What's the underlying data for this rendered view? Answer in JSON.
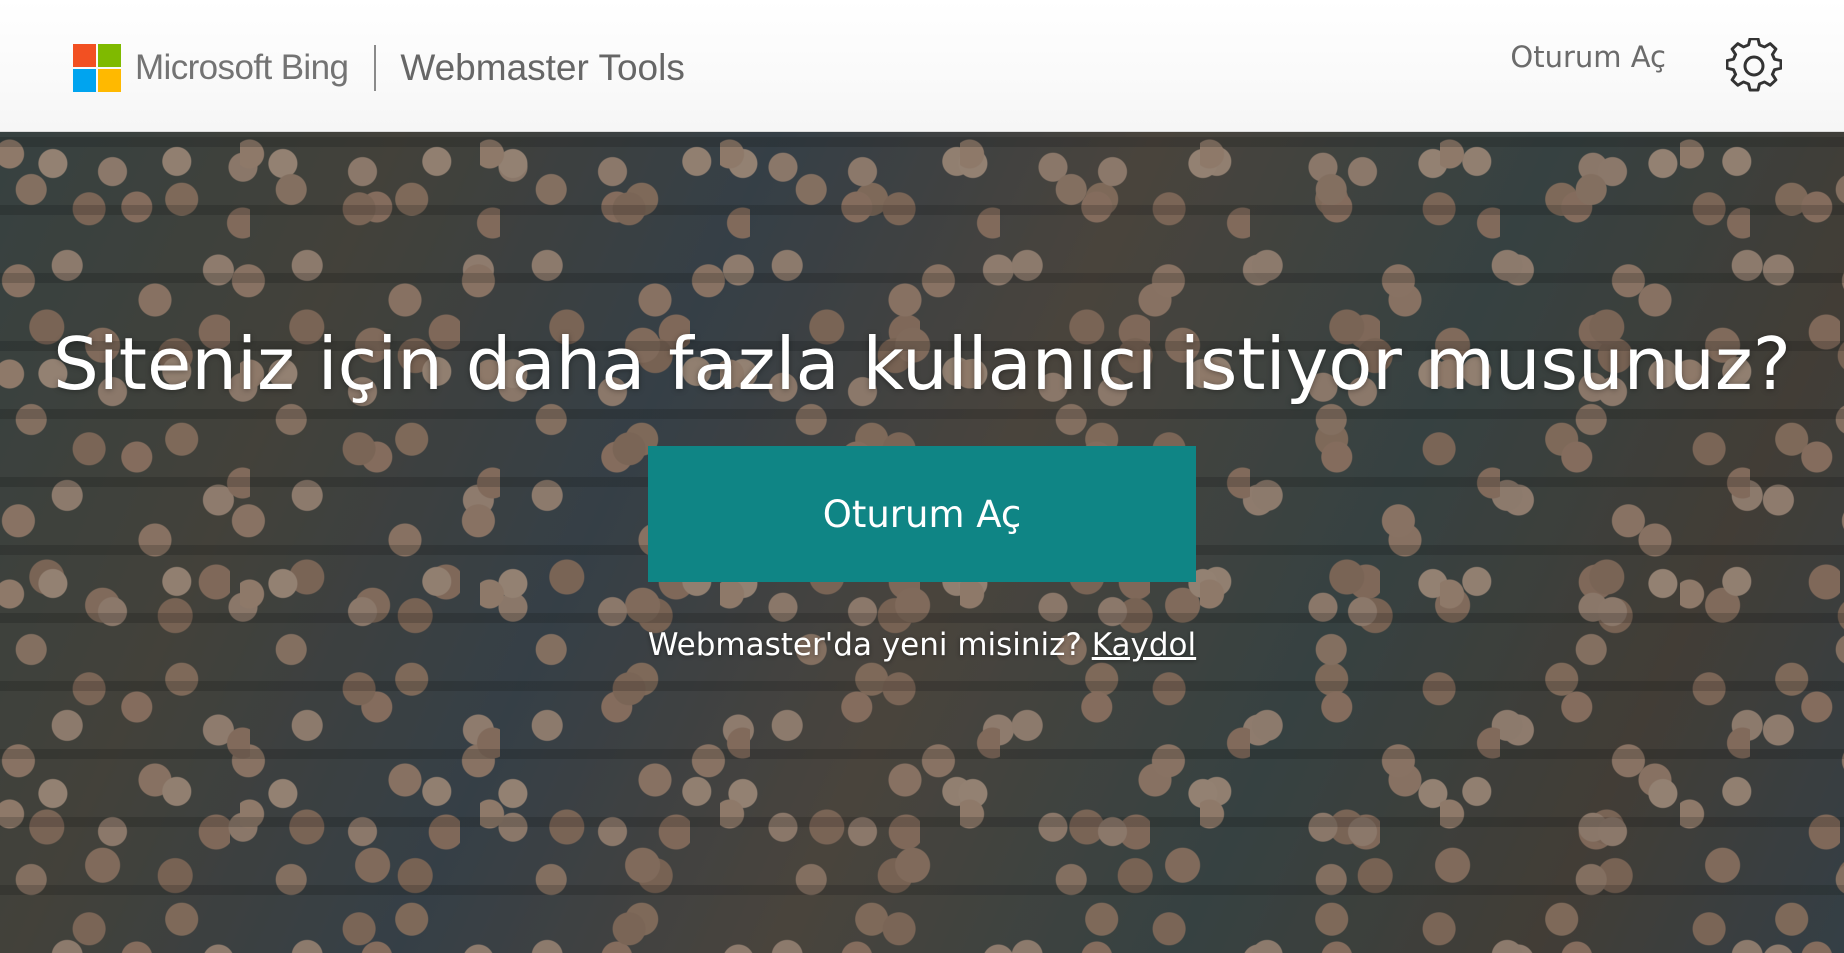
{
  "header": {
    "brand_name": "Microsoft Bing",
    "product_name": "Webmaster Tools",
    "signin_label": "Oturum Aç",
    "settings_icon": "gear-icon",
    "logo_colors": [
      "#f25022",
      "#7fba00",
      "#00a4ef",
      "#ffb900"
    ]
  },
  "hero": {
    "headline": "Siteniz için daha fazla kullanıcı istiyor musunuz?",
    "cta_label": "Oturum Aç",
    "signup_prompt": "Webmaster'da yeni misiniz?",
    "signup_link": "Kaydol"
  },
  "colors": {
    "cta_background": "#0f8585",
    "header_background": "#ffffff"
  }
}
